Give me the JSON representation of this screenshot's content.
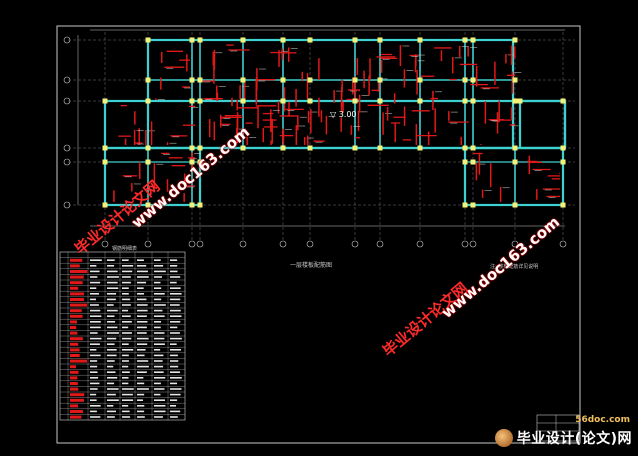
{
  "plan": {
    "caption": "一层楼板配筋图",
    "caption_id": "1/3",
    "right_note": "注: 楼板配筋详见说明",
    "scale_note": "1:100"
  },
  "table": {
    "title": "钢筋明细表"
  },
  "watermarks": {
    "cn": "毕业设计论文网",
    "url": "www.doc163.com"
  },
  "logo": {
    "site": "56doc.com",
    "text": "毕业设计(论文)网"
  },
  "colors": {
    "background": "#000000",
    "frame": "#c8c8c8",
    "beam": "#3fd0d0",
    "rebar": "#e01818",
    "column": "#f2f27a",
    "grid": "#a0a0a0",
    "dim": "#c8c8c8"
  }
}
